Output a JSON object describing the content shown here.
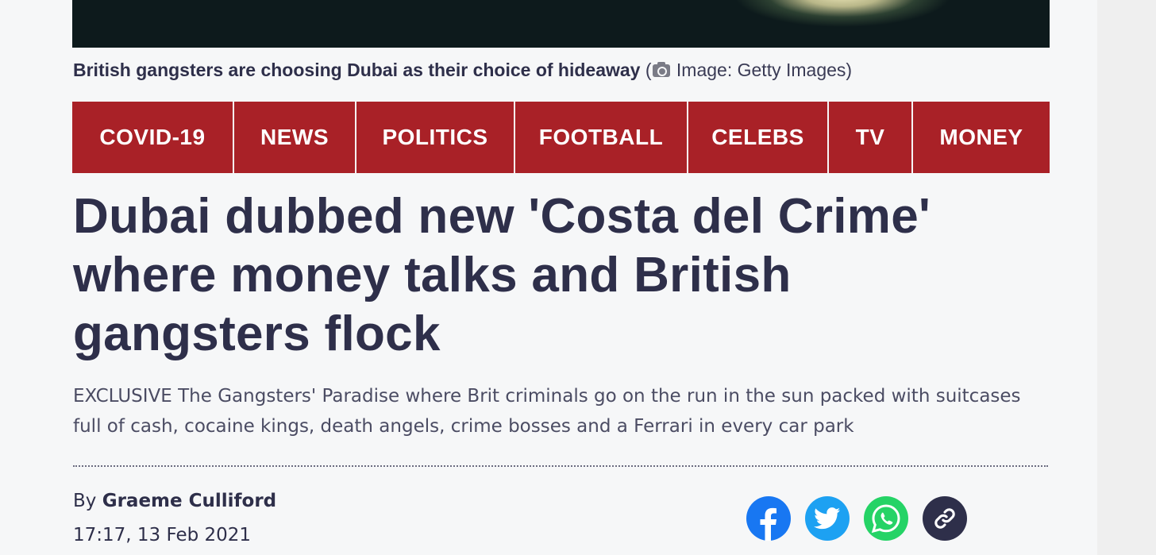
{
  "caption": {
    "text": "British gangsters are choosing Dubai as their choice of hideaway",
    "credit_open": " (",
    "credit_text": " Image: Getty Images)",
    "camera_icon": "camera-icon"
  },
  "nav": {
    "items": [
      {
        "label": "COVID-19"
      },
      {
        "label": "NEWS"
      },
      {
        "label": "POLITICS"
      },
      {
        "label": "FOOTBALL"
      },
      {
        "label": "CELEBS"
      },
      {
        "label": "TV"
      },
      {
        "label": "MONEY"
      }
    ],
    "background_color": "#a92127"
  },
  "article": {
    "headline": "Dubai dubbed new 'Costa del Crime' where money talks and British gangsters flock",
    "standfirst": "EXCLUSIVE The Gangsters' Paradise where Brit criminals go on the run in the sun packed with suitcases full of cash, cocaine kings, death angels, crime bosses and a Ferrari in every car park",
    "byline_prefix": "By ",
    "author": "Graeme Culliford",
    "timestamp": "17:17, 13 Feb 2021"
  },
  "share": {
    "buttons": [
      {
        "icon": "facebook-icon",
        "color": "#1877f2"
      },
      {
        "icon": "twitter-icon",
        "color": "#1da1f2"
      },
      {
        "icon": "whatsapp-icon",
        "color": "#25d366"
      },
      {
        "icon": "link-icon",
        "color": "#2e2f4a"
      }
    ]
  }
}
